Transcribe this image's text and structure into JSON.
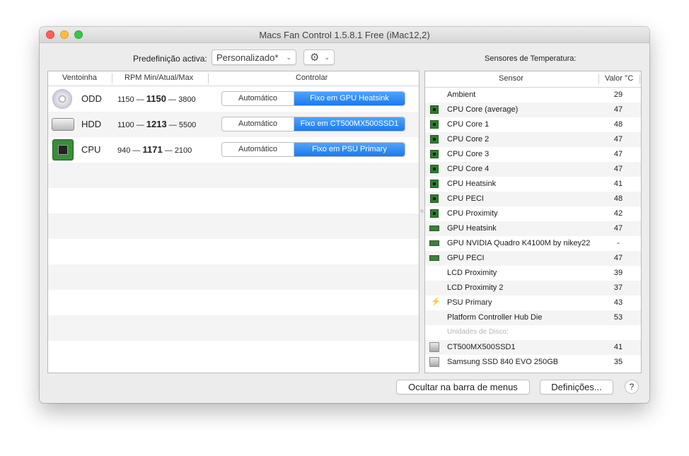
{
  "window": {
    "title": "Macs Fan Control 1.5.8.1 Free (iMac12,2)"
  },
  "toolbar": {
    "preset_label": "Predefinição activa:",
    "preset_value": "Personalizado*",
    "gear_icon": "gear-icon",
    "sensors_heading": "Sensores de Temperatura:"
  },
  "fans": {
    "headers": {
      "fan": "Ventoinha",
      "rpm": "RPM Min/Atual/Max",
      "control": "Controlar"
    },
    "rows": [
      {
        "name": "ODD",
        "min": "1150",
        "current": "1150",
        "max": "3800",
        "auto_label": "Automático",
        "fixed_label": "Fixo em GPU Heatsink",
        "icon": "optical-drive-icon"
      },
      {
        "name": "HDD",
        "min": "1100",
        "current": "1213",
        "max": "5500",
        "auto_label": "Automático",
        "fixed_label": "Fixo em CT500MX500SSD1",
        "icon": "hard-drive-icon"
      },
      {
        "name": "CPU",
        "min": "940",
        "current": "1171",
        "max": "2100",
        "auto_label": "Automático",
        "fixed_label": "Fixo em PSU Primary",
        "icon": "cpu-chip-icon"
      }
    ],
    "dash": "—"
  },
  "sensors": {
    "headers": {
      "sensor": "Sensor",
      "value": "Valor °C"
    },
    "rows": [
      {
        "name": "Ambient",
        "value": "29",
        "icon": "none"
      },
      {
        "name": "CPU Core (average)",
        "value": "47",
        "icon": "cpu-chip-icon"
      },
      {
        "name": "CPU Core 1",
        "value": "48",
        "icon": "cpu-chip-icon"
      },
      {
        "name": "CPU Core 2",
        "value": "47",
        "icon": "cpu-chip-icon"
      },
      {
        "name": "CPU Core 3",
        "value": "47",
        "icon": "cpu-chip-icon"
      },
      {
        "name": "CPU Core 4",
        "value": "47",
        "icon": "cpu-chip-icon"
      },
      {
        "name": "CPU Heatsink",
        "value": "41",
        "icon": "cpu-chip-icon"
      },
      {
        "name": "CPU PECI",
        "value": "48",
        "icon": "cpu-chip-icon"
      },
      {
        "name": "CPU Proximity",
        "value": "42",
        "icon": "cpu-chip-icon"
      },
      {
        "name": "GPU Heatsink",
        "value": "47",
        "icon": "gpu-card-icon"
      },
      {
        "name": "GPU NVIDIA Quadro K4100M by nikey22",
        "value": "-",
        "icon": "gpu-card-icon"
      },
      {
        "name": "GPU PECI",
        "value": "47",
        "icon": "gpu-card-icon"
      },
      {
        "name": "LCD Proximity",
        "value": "39",
        "icon": "none"
      },
      {
        "name": "LCD Proximity 2",
        "value": "37",
        "icon": "none"
      },
      {
        "name": "PSU Primary",
        "value": "43",
        "icon": "lightning-icon"
      },
      {
        "name": "Platform Controller Hub Die",
        "value": "53",
        "icon": "none"
      }
    ],
    "disk_group_label": "Unidades de Disco:",
    "disks": [
      {
        "name": "CT500MX500SSD1",
        "value": "41",
        "icon": "disk-icon"
      },
      {
        "name": "Samsung SSD 840 EVO 250GB",
        "value": "35",
        "icon": "disk-icon"
      }
    ]
  },
  "footer": {
    "hide_menu_bar": "Ocultar na barra de menus",
    "settings": "Definições...",
    "help": "?"
  },
  "colors": {
    "accent": "#1a7aee",
    "chip_green": "#2f7d2f"
  }
}
